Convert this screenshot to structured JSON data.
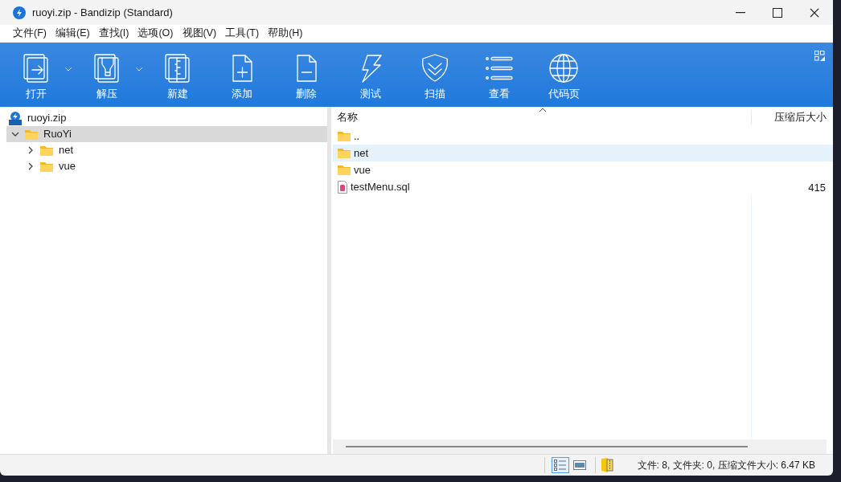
{
  "window": {
    "title": "ruoyi.zip - Bandizip (Standard)"
  },
  "menu": [
    "文件(F)",
    "编辑(E)",
    "查找(I)",
    "选项(O)",
    "视图(V)",
    "工具(T)",
    "帮助(H)"
  ],
  "toolbar": [
    {
      "kind": "open",
      "label": "打开",
      "dropdown": true
    },
    {
      "kind": "extract",
      "label": "解压",
      "dropdown": true
    },
    {
      "kind": "new",
      "label": "新建",
      "dropdown": false
    },
    {
      "kind": "add",
      "label": "添加",
      "dropdown": false
    },
    {
      "kind": "delete",
      "label": "删除",
      "dropdown": false
    },
    {
      "kind": "test",
      "label": "测试",
      "dropdown": false
    },
    {
      "kind": "scan",
      "label": "扫描",
      "dropdown": false
    },
    {
      "kind": "view",
      "label": "查看",
      "dropdown": false
    },
    {
      "kind": "codepage",
      "label": "代码页",
      "dropdown": false
    }
  ],
  "tree": {
    "archive": "ruoyi.zip",
    "items": [
      {
        "label": "RuoYi",
        "expanded": true,
        "selected": true,
        "children": [
          {
            "label": "net",
            "expanded": false,
            "selected": false
          },
          {
            "label": "vue",
            "expanded": false,
            "selected": false
          }
        ]
      }
    ]
  },
  "list": {
    "columns": [
      "名称",
      "压缩后大小"
    ],
    "rows": [
      {
        "kind": "folder",
        "name": "..",
        "selected": false
      },
      {
        "kind": "folder",
        "name": "net",
        "selected": true
      },
      {
        "kind": "folder",
        "name": "vue",
        "selected": false
      },
      {
        "kind": "file",
        "name": "testMenu.sql",
        "size": "415",
        "selected": false
      }
    ]
  },
  "status_bar": {
    "views": [
      {
        "kind": "details",
        "selected": true
      },
      {
        "kind": "preview",
        "selected": false
      }
    ],
    "text": "文件: 8, 文件夹: 0, 压缩文件大小: 6.47 KB"
  }
}
